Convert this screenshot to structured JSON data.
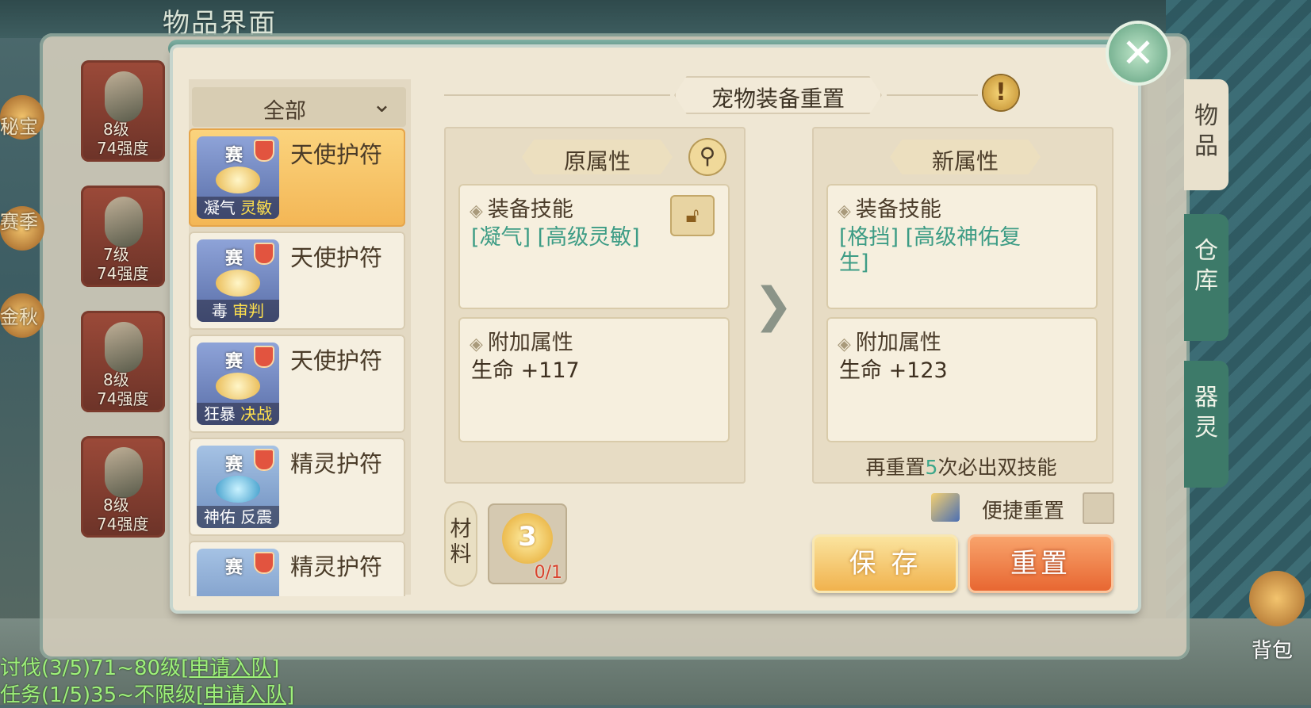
{
  "background": {
    "screen_title": "物品界面",
    "left_labels": [
      "秘宝",
      "赛季",
      "金秋"
    ],
    "items": [
      {
        "level": "8级",
        "strength": "74强度"
      },
      {
        "level": "7级",
        "strength": "74强度"
      },
      {
        "level": "8级",
        "strength": "74强度"
      },
      {
        "level": "8级",
        "strength": "74强度"
      }
    ],
    "side_tabs": [
      "物品",
      "仓库",
      "器灵"
    ],
    "bag_label": "背包",
    "bottom_lines": [
      {
        "text": "讨伐(3/5)71~80级",
        "link": "[申请入队]"
      },
      {
        "text": "任务(1/5)35~不限级",
        "link": "[申请入队]"
      }
    ]
  },
  "modal": {
    "title": "宠物装备重置",
    "info_icon": "!",
    "filter": {
      "label": "全部",
      "icon": "chevron-down"
    },
    "equipment_list": [
      {
        "name": "天使护符",
        "badge": "赛",
        "skills": [
          "凝气",
          "灵敏"
        ],
        "selected": true
      },
      {
        "name": "天使护符",
        "badge": "赛",
        "skills": [
          "毒",
          "审判"
        ],
        "selected": false
      },
      {
        "name": "天使护符",
        "badge": "赛",
        "skills": [
          "狂暴",
          "决战"
        ],
        "selected": false
      },
      {
        "name": "精灵护符",
        "badge": "赛",
        "skills": [
          "神佑",
          "反震"
        ],
        "selected": false
      },
      {
        "name": "精灵护符",
        "badge": "赛",
        "skills": [],
        "selected": false
      }
    ],
    "original": {
      "header": "原属性",
      "skill_title": "装备技能",
      "skill_value": "[凝气] [高级灵敏]",
      "attr_title": "附加属性",
      "attr_value": "生命 +117"
    },
    "new": {
      "header": "新属性",
      "skill_title": "装备技能",
      "skill_value": "[格挡] [高级神佑复生]",
      "attr_title": "附加属性",
      "attr_value": "生命 +123"
    },
    "hint": {
      "prefix": "再重置",
      "count": "5",
      "suffix": "次必出双技能"
    },
    "quick_reset_label": "便捷重置",
    "material": {
      "tab_label": "材料",
      "item_number": "3",
      "count": "0/1"
    },
    "buttons": {
      "save": "保 存",
      "reset": "重置"
    },
    "colors": {
      "accent_teal": "#3d9c85",
      "save_button": "#f0b04a",
      "reset_button": "#e7642f"
    }
  }
}
